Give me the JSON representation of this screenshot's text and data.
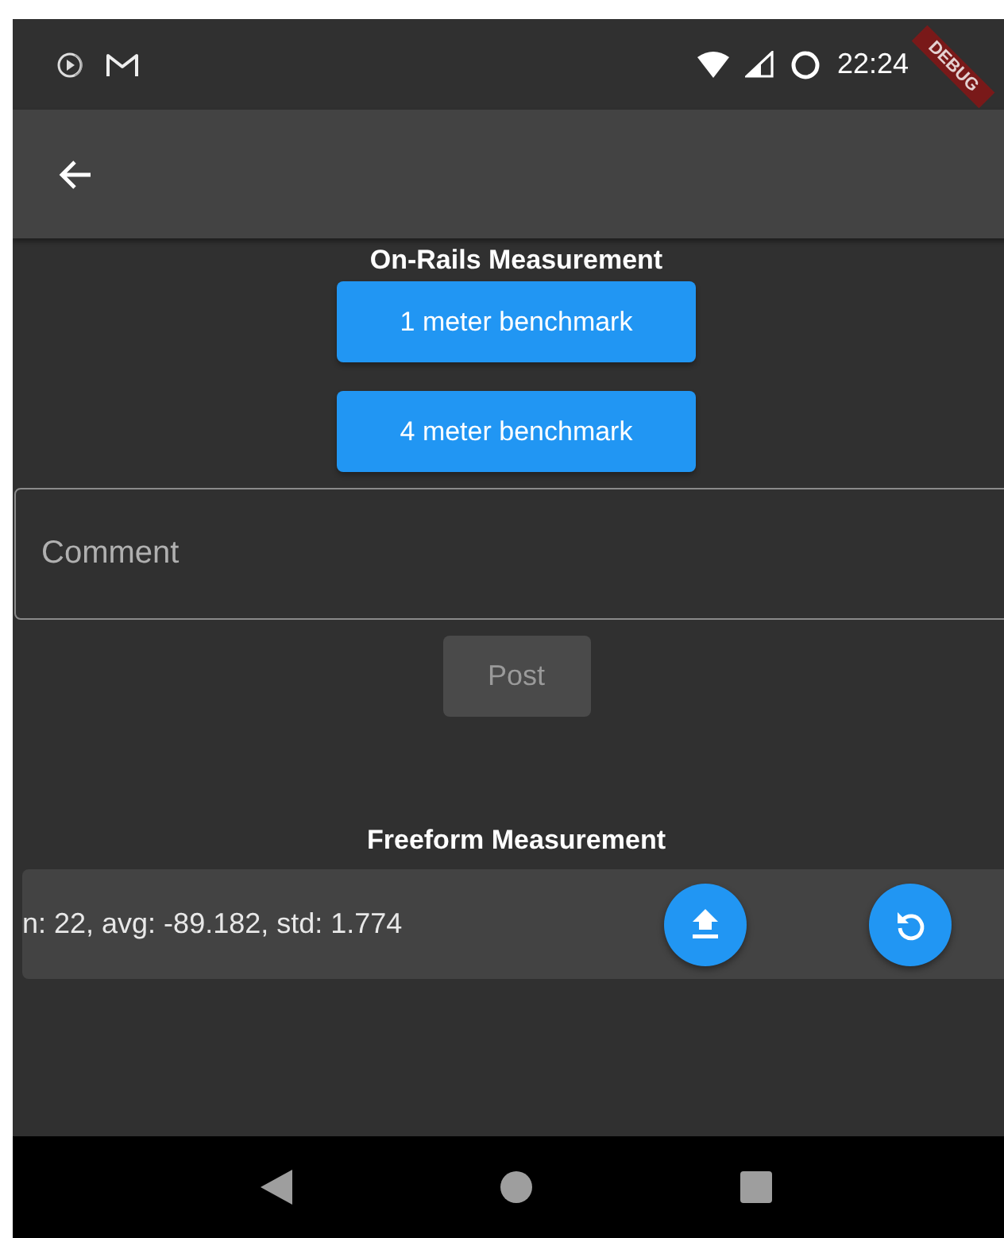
{
  "status_bar": {
    "time": "22:24"
  },
  "debug_banner": {
    "label": "DEBUG"
  },
  "on_rails": {
    "title": "On-Rails Measurement",
    "buttons": [
      "1 meter benchmark",
      "4 meter benchmark"
    ]
  },
  "comment": {
    "placeholder": "Comment"
  },
  "post_button": {
    "label": "Post",
    "disabled": true
  },
  "freeform": {
    "title": "Freeform Measurement",
    "stats": "n: 22, avg: -89.182, std: 1.774"
  }
}
